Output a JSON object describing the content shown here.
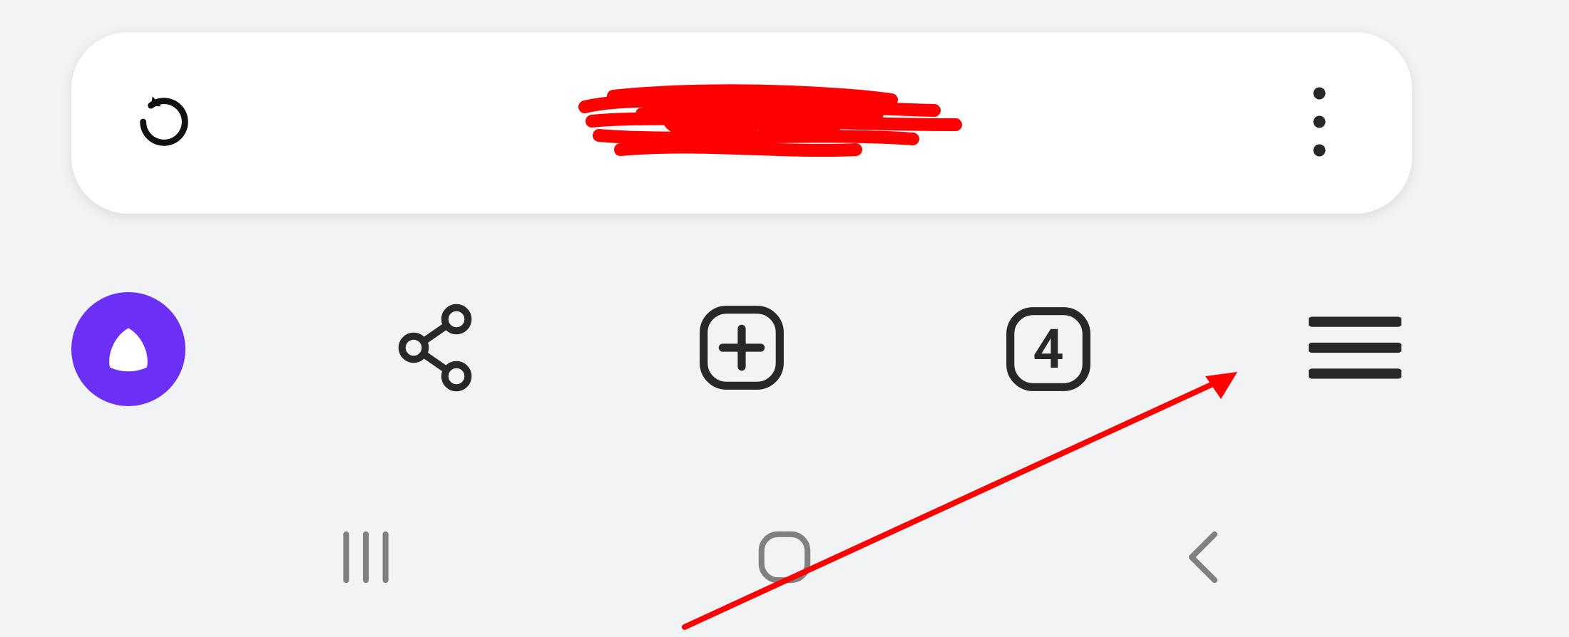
{
  "address_bar": {
    "url_display": "",
    "url_redacted": true
  },
  "toolbar": {
    "tab_count": "4"
  },
  "colors": {
    "alice_purple": "#6b2ff5",
    "bg": "#f2f3f5",
    "icon_dark": "#282828",
    "nav_gray": "#808080",
    "annotation_red": "#ff0000"
  }
}
